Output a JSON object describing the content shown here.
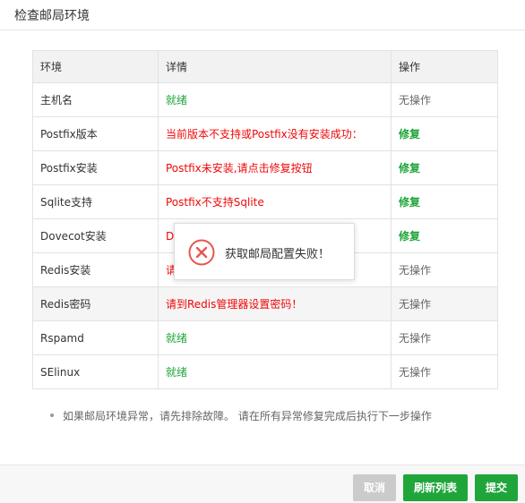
{
  "dialog": {
    "title": "检查邮局环境"
  },
  "table": {
    "headers": [
      "环境",
      "详情",
      "操作"
    ],
    "rows": [
      {
        "env": "主机名",
        "detail": "就绪",
        "action": "无操作"
      },
      {
        "env": "Postfix版本",
        "detail": "当前版本不支持或Postfix没有安装成功：",
        "action": "修复"
      },
      {
        "env": "Postfix安装",
        "detail": "Postfix未安装,请点击修复按钮",
        "action": "修复"
      },
      {
        "env": "Sqlite支持",
        "detail": "Postfix不支持Sqlite",
        "action": "修复"
      },
      {
        "env": "Dovecot安装",
        "detail": "Do",
        "action": "修复"
      },
      {
        "env": "Redis安装",
        "detail": "请",
        "action": "无操作"
      },
      {
        "env": "Redis密码",
        "detail": "请到Redis管理器设置密码！",
        "action": "无操作"
      },
      {
        "env": "Rspamd",
        "detail": "就绪",
        "action": "无操作"
      },
      {
        "env": "SElinux",
        "detail": "就绪",
        "action": "无操作"
      }
    ]
  },
  "note": "如果邮局环境异常，请先排除故障。 请在所有异常修复完成后执行下一步操作",
  "footer": {
    "cancel": "取消",
    "refresh": "刷新列表",
    "submit": "提交"
  },
  "toast": {
    "message": "获取邮局配置失败！",
    "icon": "error-circle-icon"
  },
  "colors": {
    "ok": "#20a53a",
    "error": "#ef0808",
    "accent": "#20a53a",
    "disabled": "#cbcbcb"
  }
}
